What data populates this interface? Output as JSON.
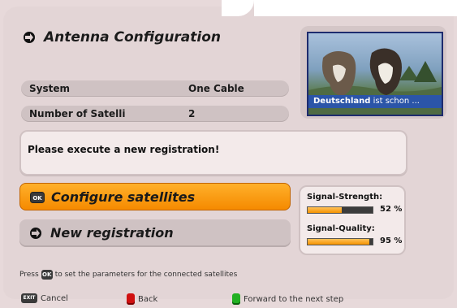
{
  "title": "Antenna Configuration",
  "settings": [
    {
      "label": "System",
      "value": "One Cable"
    },
    {
      "label": "Number of Satellit‹",
      "value": "2"
    }
  ],
  "video": {
    "caption_bold": "Deutschland",
    "caption_rest": " ist schon ..."
  },
  "message": "Please execute a new registration!",
  "buttons": {
    "configure": "Configure satellites",
    "new_registration": "New registration"
  },
  "signal": {
    "strength_label": "Signal-Strength:",
    "strength_value": "52 %",
    "strength_fraction": 0.52,
    "quality_label": "Signal-Quality:",
    "quality_value": "95 %",
    "quality_fraction": 0.95
  },
  "hint": {
    "prefix": "Press",
    "key": "OK",
    "suffix": "to set the parameters for the connected satellites"
  },
  "footer": {
    "exit_key": "EXIT",
    "cancel": "Cancel",
    "back": "Back",
    "forward": "Forward to the next step"
  },
  "colors": {
    "accent": "#f58a00",
    "panel": "#e3d5d6",
    "caption_bar": "#2b55a8"
  }
}
